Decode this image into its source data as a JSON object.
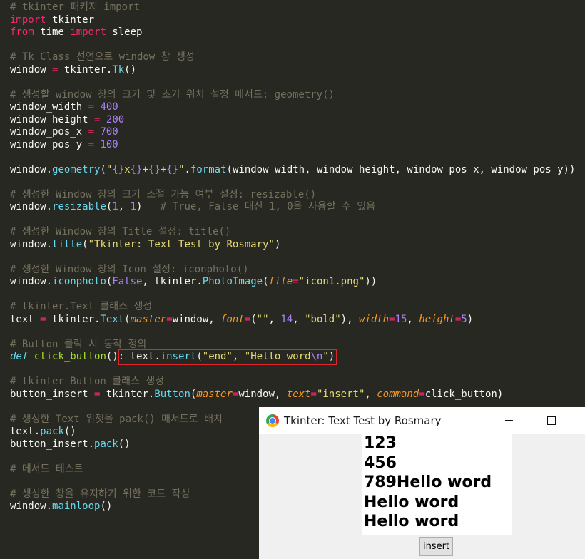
{
  "code": {
    "lines": [
      [
        {
          "c": "cm",
          "t": "# tkinter 패키지 import"
        }
      ],
      [
        {
          "c": "kw",
          "t": "import"
        },
        {
          "c": "plain",
          "t": " tkinter"
        }
      ],
      [
        {
          "c": "kw",
          "t": "from"
        },
        {
          "c": "plain",
          "t": " time "
        },
        {
          "c": "kw",
          "t": "import"
        },
        {
          "c": "plain",
          "t": " sleep"
        }
      ],
      [],
      [
        {
          "c": "cm",
          "t": "# Tk Class 선언으로 window 창 생성"
        }
      ],
      [
        {
          "c": "plain",
          "t": "window "
        },
        {
          "c": "kw",
          "t": "="
        },
        {
          "c": "plain",
          "t": " tkinter."
        },
        {
          "c": "fn",
          "t": "Tk"
        },
        {
          "c": "plain",
          "t": "()"
        }
      ],
      [],
      [
        {
          "c": "cm",
          "t": "# 생성할 window 창의 크기 및 초기 위치 설정 매서드: geometry()"
        }
      ],
      [
        {
          "c": "plain",
          "t": "window_width "
        },
        {
          "c": "kw",
          "t": "="
        },
        {
          "c": "plain",
          "t": " "
        },
        {
          "c": "num",
          "t": "400"
        }
      ],
      [
        {
          "c": "plain",
          "t": "window_height "
        },
        {
          "c": "kw",
          "t": "="
        },
        {
          "c": "plain",
          "t": " "
        },
        {
          "c": "num",
          "t": "200"
        }
      ],
      [
        {
          "c": "plain",
          "t": "window_pos_x "
        },
        {
          "c": "kw",
          "t": "="
        },
        {
          "c": "plain",
          "t": " "
        },
        {
          "c": "num",
          "t": "700"
        }
      ],
      [
        {
          "c": "plain",
          "t": "window_pos_y "
        },
        {
          "c": "kw",
          "t": "="
        },
        {
          "c": "plain",
          "t": " "
        },
        {
          "c": "num",
          "t": "100"
        }
      ],
      [],
      [
        {
          "c": "plain",
          "t": "window."
        },
        {
          "c": "fn",
          "t": "geometry"
        },
        {
          "c": "plain",
          "t": "("
        },
        {
          "c": "str",
          "t": "\""
        },
        {
          "c": "num",
          "t": "{}"
        },
        {
          "c": "str",
          "t": "x"
        },
        {
          "c": "num",
          "t": "{}"
        },
        {
          "c": "str",
          "t": "+"
        },
        {
          "c": "num",
          "t": "{}"
        },
        {
          "c": "str",
          "t": "+"
        },
        {
          "c": "num",
          "t": "{}"
        },
        {
          "c": "str",
          "t": "\""
        },
        {
          "c": "plain",
          "t": "."
        },
        {
          "c": "fn",
          "t": "format"
        },
        {
          "c": "plain",
          "t": "(window_width, window_height, window_pos_x, window_pos_y))"
        }
      ],
      [],
      [
        {
          "c": "cm",
          "t": "# 생성한 Window 창의 크기 조절 가능 여부 설정: resizable()"
        }
      ],
      [
        {
          "c": "plain",
          "t": "window."
        },
        {
          "c": "fn",
          "t": "resizable"
        },
        {
          "c": "plain",
          "t": "("
        },
        {
          "c": "num",
          "t": "1"
        },
        {
          "c": "plain",
          "t": ", "
        },
        {
          "c": "num",
          "t": "1"
        },
        {
          "c": "plain",
          "t": ")   "
        },
        {
          "c": "cm",
          "t": "# True, False 대신 1, 0을 사용할 수 있음"
        }
      ],
      [],
      [
        {
          "c": "cm",
          "t": "# 생성한 Window 창의 Title 설정: title()"
        }
      ],
      [
        {
          "c": "plain",
          "t": "window."
        },
        {
          "c": "fn",
          "t": "title"
        },
        {
          "c": "plain",
          "t": "("
        },
        {
          "c": "str",
          "t": "\"Tkinter: Text Test by Rosmary\""
        },
        {
          "c": "plain",
          "t": ")"
        }
      ],
      [],
      [
        {
          "c": "cm",
          "t": "# 생성한 Window 창의 Icon 설정: iconphoto()"
        }
      ],
      [
        {
          "c": "plain",
          "t": "window."
        },
        {
          "c": "fn",
          "t": "iconphoto"
        },
        {
          "c": "plain",
          "t": "("
        },
        {
          "c": "num",
          "t": "False"
        },
        {
          "c": "plain",
          "t": ", tkinter."
        },
        {
          "c": "fn",
          "t": "PhotoImage"
        },
        {
          "c": "plain",
          "t": "("
        },
        {
          "c": "par",
          "t": "file"
        },
        {
          "c": "kw",
          "t": "="
        },
        {
          "c": "str",
          "t": "\"icon1.png\""
        },
        {
          "c": "plain",
          "t": "))"
        }
      ],
      [],
      [
        {
          "c": "cm",
          "t": "# tkinter.Text 클래스 생성"
        }
      ],
      [
        {
          "c": "plain",
          "t": "text "
        },
        {
          "c": "kw",
          "t": "="
        },
        {
          "c": "plain",
          "t": " tkinter."
        },
        {
          "c": "fn",
          "t": "Text"
        },
        {
          "c": "plain",
          "t": "("
        },
        {
          "c": "par",
          "t": "master"
        },
        {
          "c": "kw",
          "t": "="
        },
        {
          "c": "plain",
          "t": "window, "
        },
        {
          "c": "par",
          "t": "font"
        },
        {
          "c": "kw",
          "t": "="
        },
        {
          "c": "plain",
          "t": "("
        },
        {
          "c": "str",
          "t": "\"\""
        },
        {
          "c": "plain",
          "t": ", "
        },
        {
          "c": "num",
          "t": "14"
        },
        {
          "c": "plain",
          "t": ", "
        },
        {
          "c": "str",
          "t": "\"bold\""
        },
        {
          "c": "plain",
          "t": "), "
        },
        {
          "c": "par",
          "t": "width"
        },
        {
          "c": "kw",
          "t": "="
        },
        {
          "c": "num",
          "t": "15"
        },
        {
          "c": "plain",
          "t": ", "
        },
        {
          "c": "par",
          "t": "height"
        },
        {
          "c": "kw",
          "t": "="
        },
        {
          "c": "num",
          "t": "5"
        },
        {
          "c": "plain",
          "t": ")"
        }
      ],
      [],
      [
        {
          "c": "cm",
          "t": "# Button 클릭 시 동작 정의"
        }
      ],
      [
        {
          "c": "def",
          "t": "def"
        },
        {
          "c": "plain",
          "t": " "
        },
        {
          "c": "fname",
          "t": "click_button"
        },
        {
          "c": "plain",
          "t": "(): text."
        },
        {
          "c": "fn",
          "t": "insert"
        },
        {
          "c": "plain",
          "t": "("
        },
        {
          "c": "str",
          "t": "\"end\""
        },
        {
          "c": "plain",
          "t": ", "
        },
        {
          "c": "str",
          "t": "\"Hello word"
        },
        {
          "c": "num",
          "t": "\\n"
        },
        {
          "c": "str",
          "t": "\""
        },
        {
          "c": "plain",
          "t": ")"
        }
      ],
      [],
      [
        {
          "c": "cm",
          "t": "# tkinter Button 클래스 생성"
        }
      ],
      [
        {
          "c": "plain",
          "t": "button_insert "
        },
        {
          "c": "kw",
          "t": "="
        },
        {
          "c": "plain",
          "t": " tkinter."
        },
        {
          "c": "fn",
          "t": "Button"
        },
        {
          "c": "plain",
          "t": "("
        },
        {
          "c": "par",
          "t": "master"
        },
        {
          "c": "kw",
          "t": "="
        },
        {
          "c": "plain",
          "t": "window, "
        },
        {
          "c": "par",
          "t": "text"
        },
        {
          "c": "kw",
          "t": "="
        },
        {
          "c": "str",
          "t": "\"insert\""
        },
        {
          "c": "plain",
          "t": ", "
        },
        {
          "c": "par",
          "t": "command"
        },
        {
          "c": "kw",
          "t": "="
        },
        {
          "c": "plain",
          "t": "click_button)"
        }
      ],
      [],
      [
        {
          "c": "cm",
          "t": "# 생성한 Text 위젯을 pack() 매서드로 배치"
        }
      ],
      [
        {
          "c": "plain",
          "t": "text."
        },
        {
          "c": "fn",
          "t": "pack"
        },
        {
          "c": "plain",
          "t": "()"
        }
      ],
      [
        {
          "c": "plain",
          "t": "button_insert."
        },
        {
          "c": "fn",
          "t": "pack"
        },
        {
          "c": "plain",
          "t": "()"
        }
      ],
      [],
      [
        {
          "c": "cm",
          "t": "# 메서드 테스트"
        }
      ],
      [],
      [
        {
          "c": "cm",
          "t": "# 생성한 창을 유지하기 위한 코드 작성"
        }
      ],
      [
        {
          "c": "plain",
          "t": "window."
        },
        {
          "c": "fn",
          "t": "mainloop"
        },
        {
          "c": "plain",
          "t": "()"
        }
      ]
    ]
  },
  "tk_window": {
    "title": "Tkinter: Text Test by Rosmary",
    "text_lines": [
      "123",
      "456",
      "789Hello word",
      "Hello word",
      "Hello word"
    ],
    "button_label": "insert"
  }
}
